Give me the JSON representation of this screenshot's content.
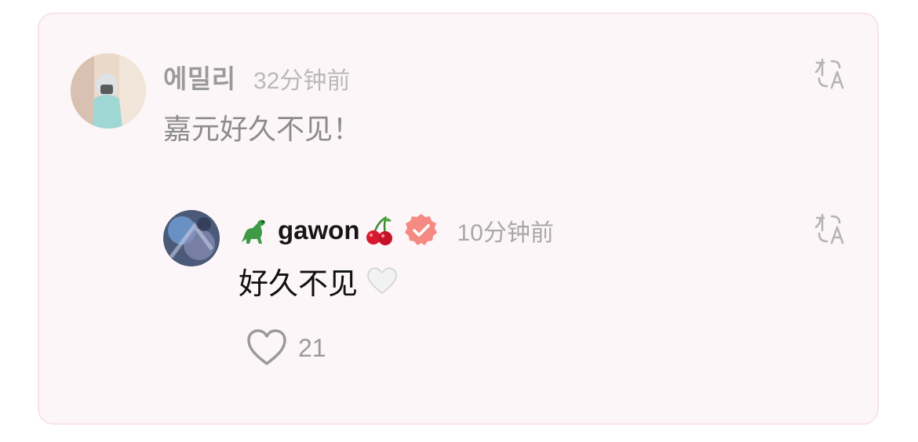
{
  "comment": {
    "username": "에밀리",
    "time": "32分钟前",
    "text": "嘉元好久不见！",
    "translate_icon": "translate-icon"
  },
  "reply": {
    "username": "gawon",
    "username_emoji_before": "dinosaur-emoji",
    "username_emoji_after": "cherries-emoji",
    "verified_badge": "verified-badge-icon",
    "time": "10分钟前",
    "text": "好久不见",
    "text_emoji": "white-heart-emoji",
    "translate_icon": "translate-icon",
    "like_icon": "heart-outline-icon",
    "like_count": "21"
  },
  "colors": {
    "card_background": "#fdf6f9",
    "card_border": "#f8e3ea",
    "badge": "#f58a83"
  }
}
